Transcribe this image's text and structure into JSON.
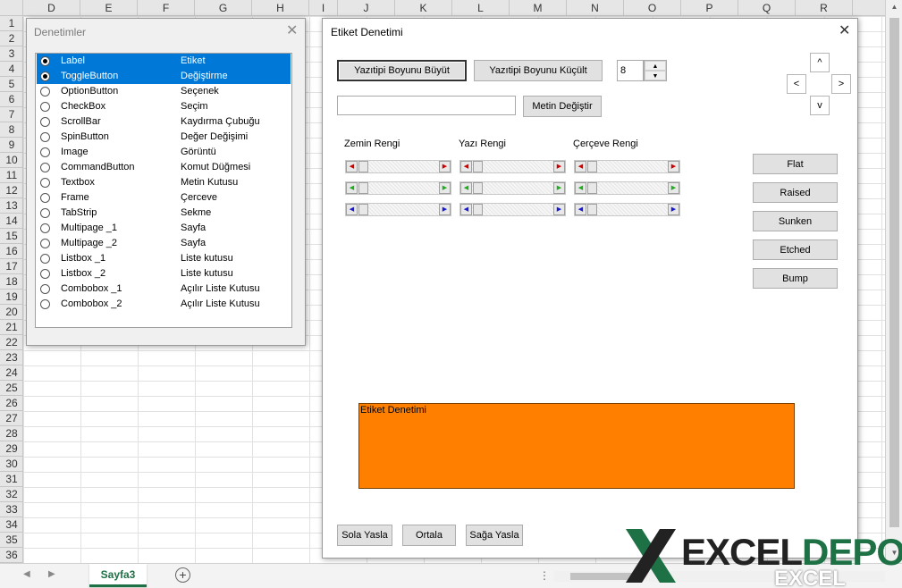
{
  "excel": {
    "columns": [
      "D",
      "E",
      "F",
      "G",
      "H",
      "I",
      "J",
      "K",
      "L",
      "M",
      "N",
      "O",
      "P",
      "Q",
      "R"
    ],
    "rows": [
      "1",
      "2",
      "3",
      "4",
      "5",
      "6",
      "7",
      "8",
      "9",
      "10",
      "11",
      "12",
      "13",
      "14",
      "15",
      "16",
      "17",
      "18",
      "19",
      "20",
      "21",
      "22",
      "23",
      "24",
      "25",
      "26",
      "27",
      "28",
      "29",
      "30",
      "31",
      "32",
      "33",
      "34",
      "35",
      "36"
    ],
    "sheet_tab": "Sayfa3",
    "add_sheet": "+",
    "tab_prev": "◀",
    "tab_next": "▶",
    "scroll_dots": "⋮"
  },
  "denetimler": {
    "title": "Denetimler",
    "close": "✕",
    "items": [
      {
        "name": "Label",
        "desc": "Etiket",
        "checked": true,
        "selected": true
      },
      {
        "name": "ToggleButton",
        "desc": "Değiştirme",
        "checked": true,
        "selected": true
      },
      {
        "name": "OptionButton",
        "desc": "Seçenek"
      },
      {
        "name": "CheckBox",
        "desc": "Seçim"
      },
      {
        "name": "ScrollBar",
        "desc": "Kaydırma Çubuğu"
      },
      {
        "name": "SpinButton",
        "desc": "Değer Değişimi"
      },
      {
        "name": "Image",
        "desc": "Görüntü"
      },
      {
        "name": "CommandButton",
        "desc": "Komut Düğmesi"
      },
      {
        "name": "Textbox",
        "desc": "Metin Kutusu"
      },
      {
        "name": "Frame",
        "desc": "Çerceve"
      },
      {
        "name": "TabStrip",
        "desc": "Sekme"
      },
      {
        "name": "Multipage _1",
        "desc": "Sayfa"
      },
      {
        "name": "Multipage _2",
        "desc": "Sayfa"
      },
      {
        "name": "Listbox _1",
        "desc": "Liste kutusu"
      },
      {
        "name": "Listbox _2",
        "desc": "Liste kutusu"
      },
      {
        "name": "Combobox _1",
        "desc": "Açılır Liste Kutusu"
      },
      {
        "name": "Combobox _2",
        "desc": "Açılır Liste Kutusu"
      }
    ]
  },
  "etiket": {
    "title": "Etiket Denetimi",
    "close": "✕",
    "font_up": "Yazıtipi Boyunu Büyüt",
    "font_down": "Yazıtipi Boyunu Küçült",
    "font_size": "8",
    "text_value": "",
    "change_text": "Metin Değiştir",
    "nav_up": "^",
    "nav_left": "<",
    "nav_right": ">",
    "nav_down": "v",
    "bg_color_label": "Zemin Rengi",
    "font_color_label": "Yazı Rengi",
    "border_color_label": "Çerçeve Rengi",
    "styles": [
      "Flat",
      "Raised",
      "Sunken",
      "Etched",
      "Bump"
    ],
    "preview_text": "Etiket Denetimi",
    "preview_color": "#ff8000",
    "align_left": "Sola Yasla",
    "align_center": "Ortala",
    "align_right": "Sağa Yasla",
    "arrow_colors": [
      "#cc0000",
      "#22aa22",
      "#1a1acc"
    ]
  },
  "logo": {
    "main_excel": "EXCEL",
    "main_depo": "DEPO",
    "sub": "EXCEL"
  }
}
